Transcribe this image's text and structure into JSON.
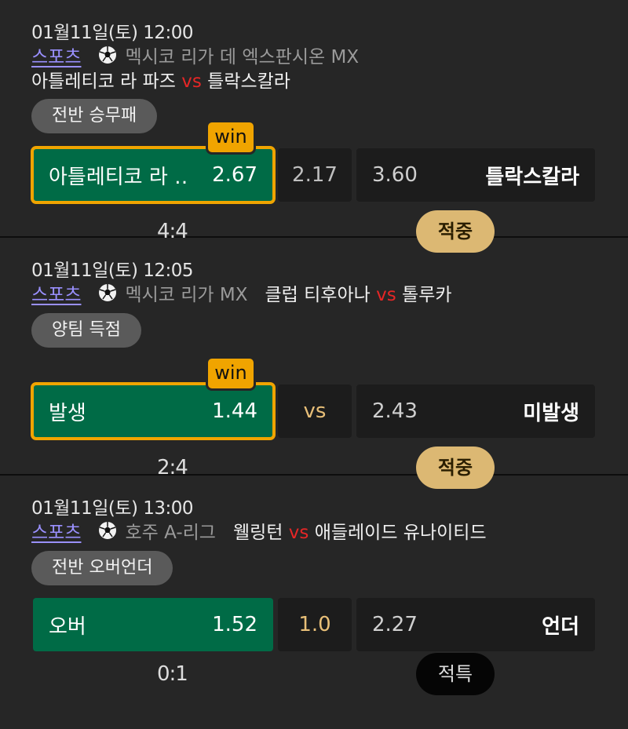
{
  "matches": [
    {
      "datetime": "01월11일(토) 12:00",
      "sport": "스포츠",
      "league": "멕시코 리가 데 엑스판시온 MX",
      "home": "아틀레티코 라 파즈",
      "vs": "vs",
      "away": "틀락스칼라",
      "market": "전반 승무패",
      "win_badge": "win",
      "selection_label": "아틀레티코 라 …",
      "odds_home": "2.67",
      "odds_mid": "2.17",
      "odds_away": "3.60",
      "away_label": "틀락스칼라",
      "score": "4:4",
      "result": "적중"
    },
    {
      "datetime": "01월11일(토) 12:05",
      "sport": "스포츠",
      "league": "멕시코 리가 MX",
      "home": "클럽 티후아나",
      "vs": "vs",
      "away": "톨루카",
      "market": "양팀 득점",
      "win_badge": "win",
      "selection_label": "발생",
      "odds_home": "1.44",
      "odds_mid": "vs",
      "odds_away": "2.43",
      "away_label": "미발생",
      "score": "2:4",
      "result": "적중"
    },
    {
      "datetime": "01월11일(토) 13:00",
      "sport": "스포츠",
      "league": "호주 A-리그",
      "home": "웰링턴",
      "vs": "vs",
      "away": "애들레이드 유나이티드",
      "market": "전반 오버언더",
      "selection_label": "오버",
      "odds_home": "1.52",
      "odds_mid": "1.0",
      "odds_away": "2.27",
      "away_label": "언더",
      "score": "0:1",
      "result": "적특"
    }
  ],
  "colors": {
    "background": "#262626",
    "selected": "#006b46",
    "win_outline": "#f0a400",
    "hit_badge": "#dcb873",
    "vs_red": "#e62626",
    "sport_link": "#9a90ff"
  },
  "icons": {
    "sport": "soccer-ball-icon"
  }
}
